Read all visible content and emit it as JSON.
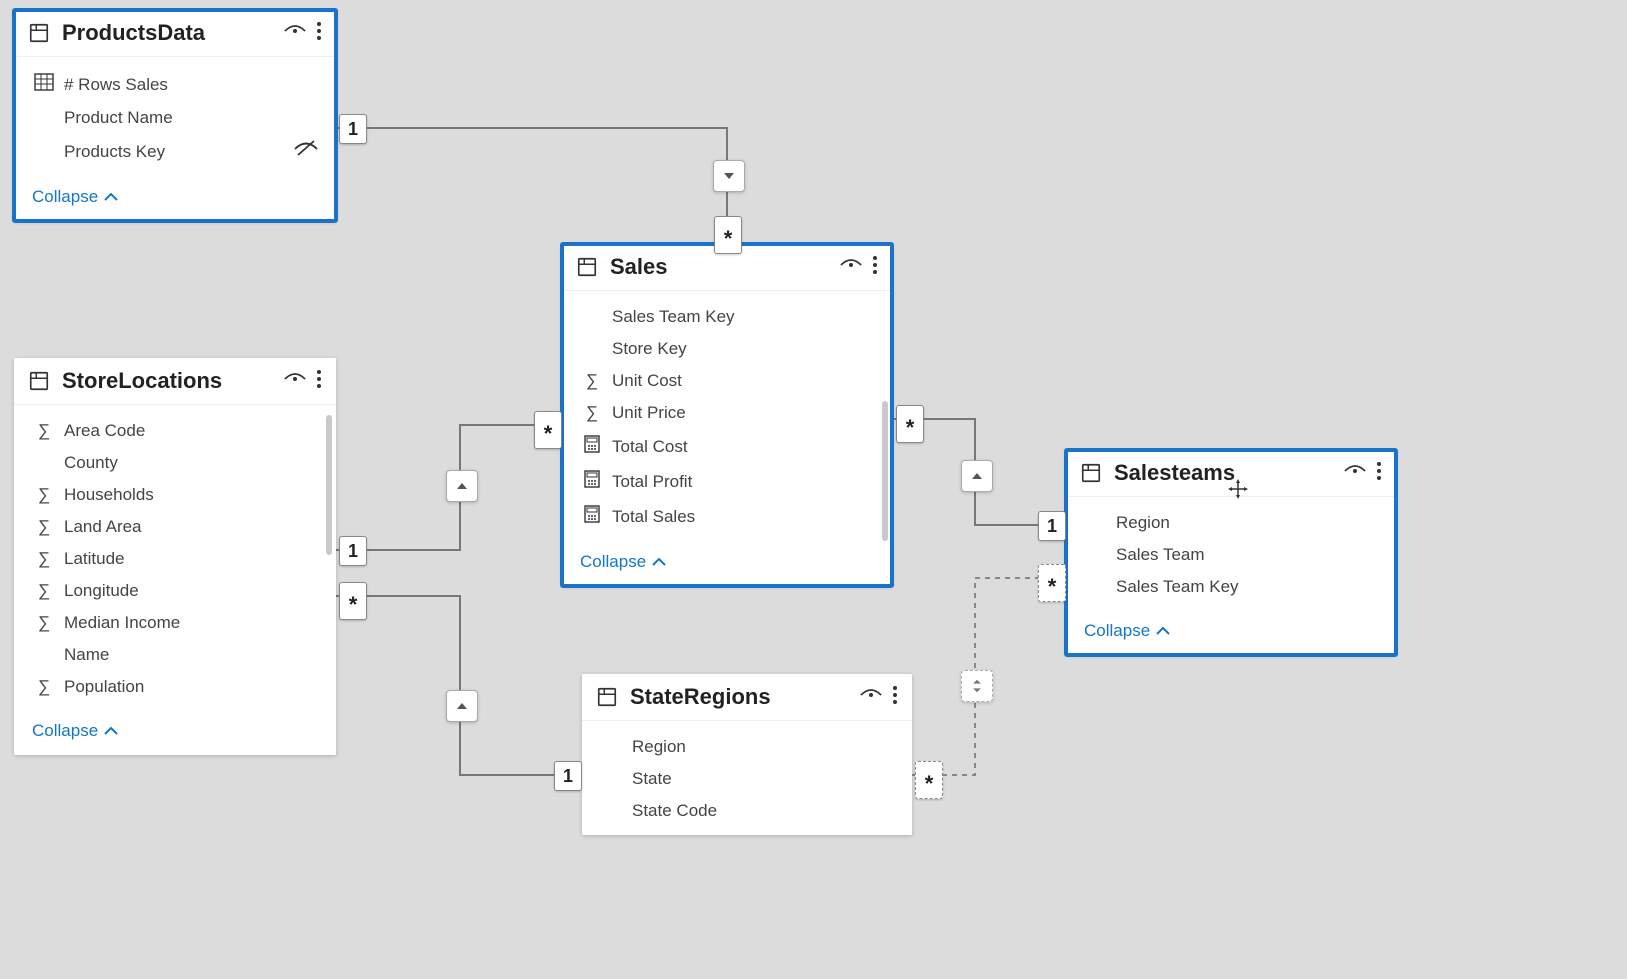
{
  "tables": {
    "products": {
      "title": "ProductsData",
      "fields": [
        {
          "name": "# Rows Sales",
          "icon": "measure-table"
        },
        {
          "name": "Product Name",
          "icon": ""
        },
        {
          "name": "Products Key",
          "icon": "",
          "hidden": true
        }
      ],
      "collapse": "Collapse"
    },
    "sales": {
      "title": "Sales",
      "fields": [
        {
          "name": "Sales Team Key",
          "icon": ""
        },
        {
          "name": "Store Key",
          "icon": ""
        },
        {
          "name": "Unit Cost",
          "icon": "sigma"
        },
        {
          "name": "Unit Price",
          "icon": "sigma"
        },
        {
          "name": "Total Cost",
          "icon": "calc"
        },
        {
          "name": "Total Profit",
          "icon": "calc"
        },
        {
          "name": "Total Sales",
          "icon": "calc"
        }
      ],
      "collapse": "Collapse"
    },
    "storelocations": {
      "title": "StoreLocations",
      "fields": [
        {
          "name": "Area Code",
          "icon": "sigma"
        },
        {
          "name": "County",
          "icon": ""
        },
        {
          "name": "Households",
          "icon": "sigma"
        },
        {
          "name": "Land Area",
          "icon": "sigma"
        },
        {
          "name": "Latitude",
          "icon": "sigma"
        },
        {
          "name": "Longitude",
          "icon": "sigma"
        },
        {
          "name": "Median Income",
          "icon": "sigma"
        },
        {
          "name": "Name",
          "icon": ""
        },
        {
          "name": "Population",
          "icon": "sigma"
        }
      ],
      "collapse": "Collapse"
    },
    "stateregions": {
      "title": "StateRegions",
      "fields": [
        {
          "name": "Region",
          "icon": ""
        },
        {
          "name": "State",
          "icon": ""
        },
        {
          "name": "State Code",
          "icon": ""
        }
      ]
    },
    "salesteams": {
      "title": "Salesteams",
      "fields": [
        {
          "name": "Region",
          "icon": ""
        },
        {
          "name": "Sales Team",
          "icon": ""
        },
        {
          "name": "Sales Team Key",
          "icon": ""
        }
      ],
      "collapse": "Collapse"
    }
  },
  "relationships": [
    {
      "from": "ProductsData",
      "from_card": "1",
      "to": "Sales",
      "to_card": "*",
      "filter": "single"
    },
    {
      "from": "StoreLocations",
      "from_card": "1",
      "to": "Sales",
      "to_card": "*",
      "filter": "single"
    },
    {
      "from": "Salesteams",
      "from_card": "1",
      "to": "Sales",
      "to_card": "*",
      "filter": "single"
    },
    {
      "from": "StateRegions",
      "from_card": "1",
      "to": "StoreLocations",
      "to_card": "*",
      "filter": "single"
    },
    {
      "from": "StateRegions",
      "from_card": "*",
      "to": "Salesteams",
      "to_card": "*",
      "filter": "both",
      "inactive": true
    }
  ]
}
